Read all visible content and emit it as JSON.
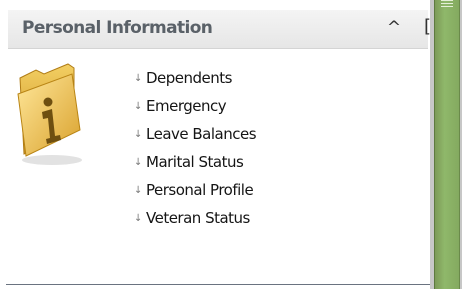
{
  "panel": {
    "title": "Personal Information",
    "collapse_icon": "^",
    "collapse_icon_name": "caret-up-icon",
    "bracket": "["
  },
  "folder_icon": "info-folder-icon",
  "links": [
    {
      "label": "Dependents"
    },
    {
      "label": "Emergency"
    },
    {
      "label": "Leave Balances"
    },
    {
      "label": "Marital Status"
    },
    {
      "label": "Personal Profile"
    },
    {
      "label": "Veteran Status"
    }
  ],
  "colors": {
    "header_bg": "#ececec",
    "title_text": "#5a6168",
    "scrollbar_green": "#8fb86a"
  }
}
